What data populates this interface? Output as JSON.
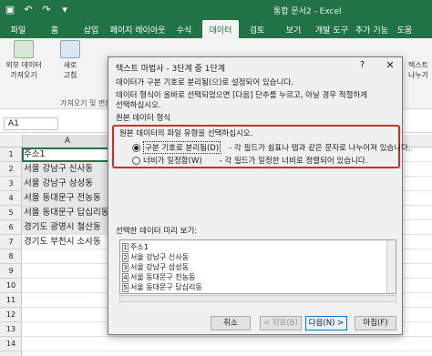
{
  "window": {
    "title": "통합 문서2 - Excel"
  },
  "ribbon_tabs": [
    {
      "label": "파일"
    },
    {
      "label": "홈"
    },
    {
      "label": "삽입"
    },
    {
      "label": "페이지 레이아웃"
    },
    {
      "label": "수식"
    },
    {
      "label": "데이터"
    },
    {
      "label": "검토"
    },
    {
      "label": "보기"
    },
    {
      "label": "개발 도구"
    },
    {
      "label": "추가 기능"
    },
    {
      "label": "도움"
    }
  ],
  "ribbon": {
    "external_data": "외부 데이터",
    "external_data2": "가져오기",
    "refresh": "새로",
    "refresh2": "고침",
    "group_label": "가져오기 및 변환",
    "text_to_columns": "텍스트",
    "text_to_columns2": "나누기"
  },
  "formula_bar": {
    "namebox": "A1"
  },
  "sheet": {
    "col_a": "A",
    "rows": [
      {
        "num": "1",
        "value": "주소1"
      },
      {
        "num": "2",
        "value": "서울 강남구 신사동"
      },
      {
        "num": "3",
        "value": "서울 강남구 삼성동"
      },
      {
        "num": "4",
        "value": "서울 동대문구 전농동"
      },
      {
        "num": "5",
        "value": "서울 동대문구 답십리동"
      },
      {
        "num": "6",
        "value": "경기도 광명시 철산동"
      },
      {
        "num": "7",
        "value": "경기도 부천시 소사동"
      },
      {
        "num": "8",
        "value": ""
      },
      {
        "num": "9",
        "value": ""
      },
      {
        "num": "10",
        "value": ""
      },
      {
        "num": "11",
        "value": ""
      },
      {
        "num": "12",
        "value": ""
      },
      {
        "num": "13",
        "value": ""
      },
      {
        "num": "14",
        "value": ""
      }
    ]
  },
  "dialog": {
    "title": "텍스트 마법사 - 3단계 중 1단계",
    "help": "?",
    "close": "✕",
    "line1": "데이터가 구분 기호로 분리됨(으)로 설정되어 있습니다.",
    "line2": "데이터 형식이 올바로 선택되었으면 [다음] 단추를 누르고, 아닐 경우 적절하게",
    "line3": "선택하십시오.",
    "fieldset_label": "원본 데이터 형식",
    "choose_label": "원본 데이터의 파일 유형을 선택하십시오.",
    "option_delimited": "구분 기호로 분리됨(D)",
    "option_delimited_desc": "- 각 필드가 쉼표나 탭과 같은 문자로 나누어져 있습니다.",
    "option_fixed": "너비가 일정함(W)",
    "option_fixed_desc": "- 각 필드가 일정한 너비로 정렬되어 있습니다.",
    "preview_label": "선택한 데이터 미리 보기:",
    "preview_rows": [
      {
        "n": "1",
        "text": "주소1"
      },
      {
        "n": "2",
        "text": "서울 강남구 신사동"
      },
      {
        "n": "3",
        "text": "서울 강남구 삼성동"
      },
      {
        "n": "4",
        "text": "서울 동대문구 전농동"
      },
      {
        "n": "5",
        "text": "서울 동대문구 답십리동"
      }
    ],
    "btn_cancel": "취소",
    "btn_back": "< 뒤로(B)",
    "btn_next": "다음(N) >",
    "btn_finish": "마침(F)"
  },
  "colors": {
    "excel_green": "#217346",
    "highlight_red": "#d52b2b"
  }
}
